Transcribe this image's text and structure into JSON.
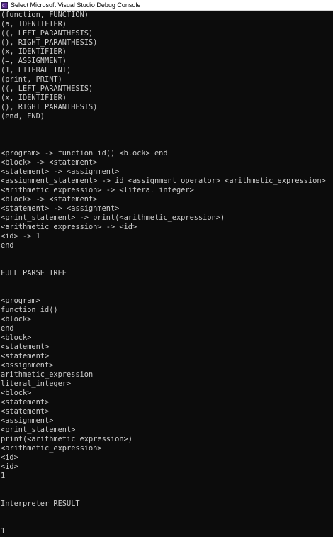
{
  "window": {
    "title": "Select Microsoft Visual Studio Debug Console",
    "icon": "C:\\",
    "icon_name": "vs-debug-console-icon"
  },
  "console": {
    "lines": [
      "(function, FUNCTION)",
      "(a, IDENTIFIER)",
      "((, LEFT_PARANTHESIS)",
      "(), RIGHT_PARANTHESIS)",
      "(x, IDENTIFIER)",
      "(=, ASSIGNMENT)",
      "(1, LITERAL_INT)",
      "(print, PRINT)",
      "((, LEFT_PARANTHESIS)",
      "(x, IDENTIFIER)",
      "(), RIGHT_PARANTHESIS)",
      "(end, END)",
      "",
      "",
      "",
      "<program> -> function id() <block> end",
      "<block> -> <statement>",
      "<statement> -> <assignment>",
      "<assignment_statement> -> id <assignment operator> <arithmetic_expression>",
      "<arithmetic_expression> -> <literal_integer>",
      "<block> -> <statement>",
      "<statement> -> <assignment>",
      "<print_statement> -> print(<arithmetic_expression>)",
      "<arithmetic_expression> -> <id>",
      "<id> -> 1",
      "end",
      "",
      "",
      "FULL PARSE TREE",
      "",
      "",
      "<program>",
      "function id()",
      "<block>",
      "end",
      "<block>",
      "<statement>",
      "<statement>",
      "<assignment>",
      "arithmetic_expression",
      "literal_integer>",
      "<block>",
      "<statement>",
      "<statement>",
      "<assignment>",
      "<print_statement>",
      "print(<arithmetic_expression>)",
      "<arithmetic_expression>",
      "<id>",
      "<id>",
      "1",
      "",
      "",
      "Interpreter RESULT",
      "",
      "",
      "1"
    ]
  }
}
